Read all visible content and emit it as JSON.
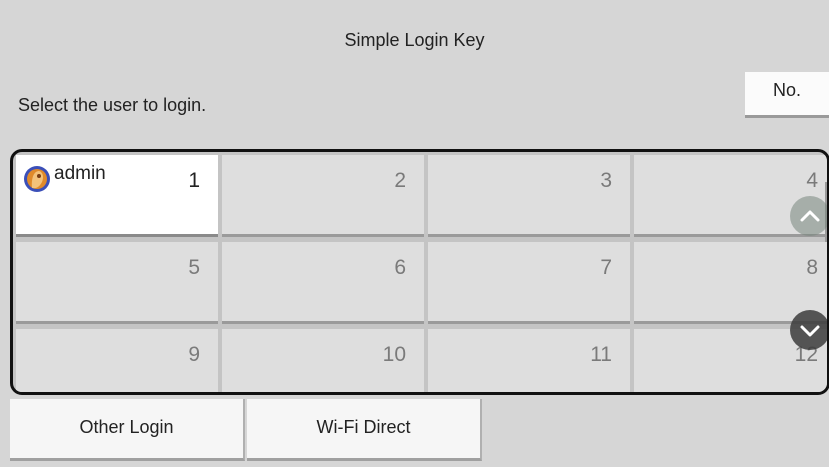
{
  "header": {
    "title": "Simple Login Key"
  },
  "prompt": "Select the user to login.",
  "no_button_label": "No.",
  "tiles": [
    {
      "number": "1",
      "user": "admin"
    },
    {
      "number": "2",
      "user": ""
    },
    {
      "number": "3",
      "user": ""
    },
    {
      "number": "4",
      "user": ""
    },
    {
      "number": "5",
      "user": ""
    },
    {
      "number": "6",
      "user": ""
    },
    {
      "number": "7",
      "user": ""
    },
    {
      "number": "8",
      "user": ""
    },
    {
      "number": "9",
      "user": ""
    },
    {
      "number": "10",
      "user": ""
    },
    {
      "number": "11",
      "user": ""
    },
    {
      "number": "12",
      "user": ""
    }
  ],
  "scroll": {
    "up_icon": "chevron-up-icon",
    "down_icon": "chevron-down-icon"
  },
  "footer": {
    "other_login_label": "Other Login",
    "wifi_direct_label": "Wi-Fi Direct"
  },
  "colors": {
    "background": "#d6d6d6",
    "tile": "#dedede",
    "selected_tile": "#ffffff",
    "frame": "#111111"
  }
}
